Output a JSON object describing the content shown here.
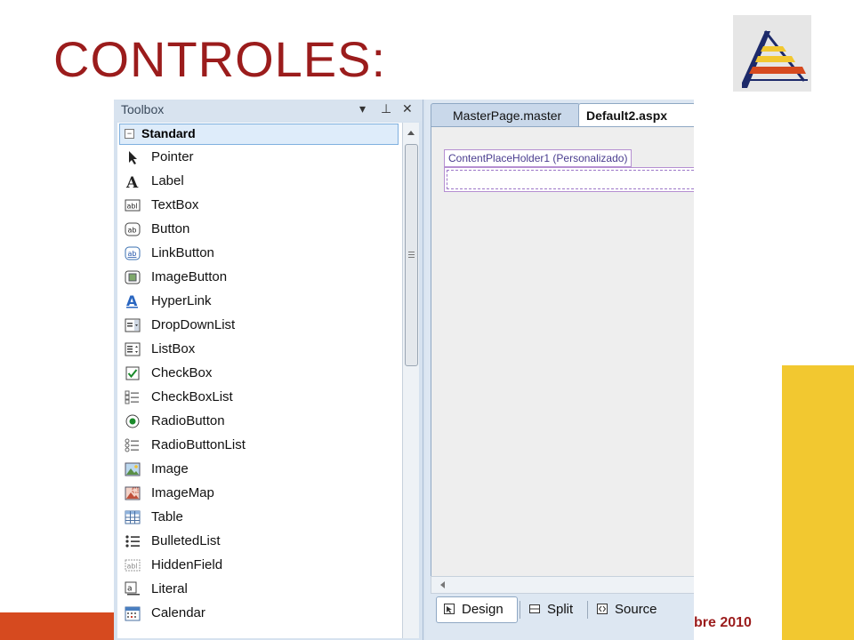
{
  "slide": {
    "title": "CONTROLES:",
    "footer_date": "bre 2010",
    "colors": {
      "title": "#9b1c1c",
      "yellow": "#f2c830",
      "red": "#d64a1f"
    }
  },
  "toolbox": {
    "title": "Toolbox",
    "controls": {
      "dropdown": "▾",
      "pin": "⊥",
      "close": "✕"
    },
    "group": "Standard",
    "items": [
      {
        "label": "Pointer",
        "icon": "pointer-icon"
      },
      {
        "label": "Label",
        "icon": "label-icon"
      },
      {
        "label": "TextBox",
        "icon": "textbox-icon"
      },
      {
        "label": "Button",
        "icon": "button-icon"
      },
      {
        "label": "LinkButton",
        "icon": "linkbutton-icon"
      },
      {
        "label": "ImageButton",
        "icon": "imagebutton-icon"
      },
      {
        "label": "HyperLink",
        "icon": "hyperlink-icon"
      },
      {
        "label": "DropDownList",
        "icon": "dropdownlist-icon"
      },
      {
        "label": "ListBox",
        "icon": "listbox-icon"
      },
      {
        "label": "CheckBox",
        "icon": "checkbox-icon"
      },
      {
        "label": "CheckBoxList",
        "icon": "checkboxlist-icon"
      },
      {
        "label": "RadioButton",
        "icon": "radiobutton-icon"
      },
      {
        "label": "RadioButtonList",
        "icon": "radiobuttonlist-icon"
      },
      {
        "label": "Image",
        "icon": "image-icon"
      },
      {
        "label": "ImageMap",
        "icon": "imagemap-icon"
      },
      {
        "label": "Table",
        "icon": "table-icon"
      },
      {
        "label": "BulletedList",
        "icon": "bulletedlist-icon"
      },
      {
        "label": "HiddenField",
        "icon": "hiddenfield-icon"
      },
      {
        "label": "Literal",
        "icon": "literal-icon"
      },
      {
        "label": "Calendar",
        "icon": "calendar-icon"
      }
    ]
  },
  "designer": {
    "tabs": [
      {
        "label": "MasterPage.master",
        "active": false
      },
      {
        "label": "Default2.aspx",
        "active": true
      }
    ],
    "placeholder_label": "ContentPlaceHolder1 (Personalizado)",
    "views": [
      {
        "label": "Design",
        "active": true
      },
      {
        "label": "Split",
        "active": false
      },
      {
        "label": "Source",
        "active": false
      }
    ]
  }
}
